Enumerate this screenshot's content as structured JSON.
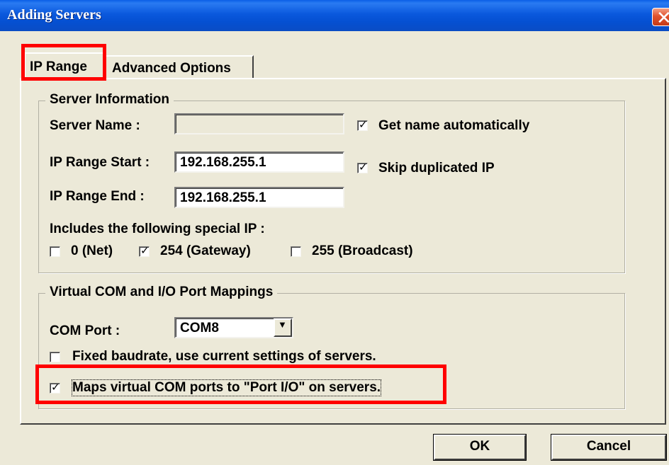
{
  "window": {
    "title": "Adding Servers"
  },
  "tabs": [
    {
      "label": "IP Range",
      "selected": true
    },
    {
      "label": "Advanced Options",
      "selected": false
    }
  ],
  "server_information": {
    "group_title": "Server Information",
    "server_name_label": "Server Name :",
    "server_name_value": "",
    "get_name_auto_label": "Get name automatically",
    "get_name_auto_checked": true,
    "ip_start_label": "IP Range Start :",
    "ip_start_value": "192.168.255.1",
    "skip_dup_label": "Skip duplicated IP",
    "skip_dup_checked": true,
    "ip_end_label": "IP Range End :",
    "ip_end_value": "192.168.255.1",
    "special_ip_label": "Includes the following special IP :",
    "special_ip": [
      {
        "label": "0 (Net)",
        "checked": false
      },
      {
        "label": "254 (Gateway)",
        "checked": true
      },
      {
        "label": "255 (Broadcast)",
        "checked": false
      }
    ]
  },
  "virtual_com": {
    "group_title": "Virtual COM and I/O Port Mappings",
    "com_port_label": "COM Port :",
    "com_port_value": "COM8",
    "fixed_baud_label": "Fixed baudrate, use current settings of servers.",
    "fixed_baud_checked": false,
    "maps_label": "Maps virtual COM ports to \"Port I/O\" on servers.",
    "maps_checked": true
  },
  "buttons": {
    "ok": "OK",
    "cancel": "Cancel"
  },
  "icons": {
    "close": "close-icon",
    "check": "check-icon",
    "dropdown": "chevron-down-icon"
  },
  "colors": {
    "titlebar": "#0a58dd",
    "dialog_bg": "#ece9d8",
    "highlight": "#ff0000",
    "close_button": "#e0522e"
  }
}
